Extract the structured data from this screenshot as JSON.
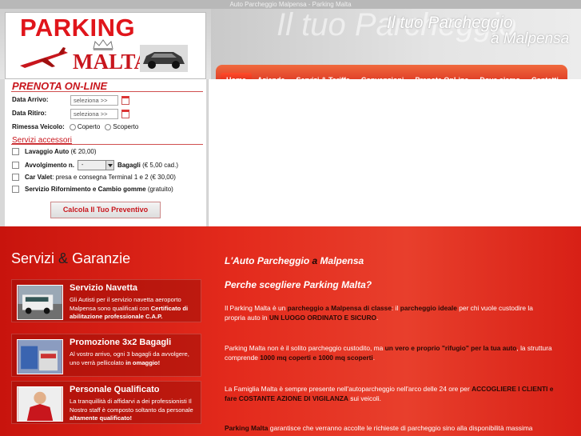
{
  "page_title": "Auto Parcheggio Malpensa - Parking Malta",
  "logo": {
    "line1": "PARKING",
    "line2": "MALTA"
  },
  "header": {
    "ghost_text": "Il tuo Parcheggio",
    "tagline_line1": "Il tuo Parcheggio",
    "tagline_line2": "a Malpensa"
  },
  "nav": [
    {
      "label": "Home"
    },
    {
      "label": "Azienda"
    },
    {
      "label": "Servizi & Tariffe"
    },
    {
      "label": "Convenzioni"
    },
    {
      "label": "Prenota OnLine"
    },
    {
      "label": "Dove siamo"
    },
    {
      "label": "Contatti"
    }
  ],
  "form": {
    "title": "PRENOTA ON-LINE",
    "arrivo_label": "Data Arrivo:",
    "arrivo_value": "seleziona >>",
    "ritiro_label": "Data Ritiro:",
    "ritiro_value": "seleziona >>",
    "rimessa_label": "Rimessa Veicolo:",
    "rimessa_opt1": "Coperto",
    "rimessa_opt2": "Scoperto",
    "servizi_title": "Servizi accessori",
    "lavaggio_label": "Lavaggio Auto",
    "lavaggio_price": "(€ 20,00)",
    "avvolgimento_label": "Avvolgimento n.",
    "avvolgimento_select": "-",
    "bagagli_label": "Bagagli",
    "bagagli_price": "(€ 5,00 cad.)",
    "valet_label": "Car Valet",
    "valet_text": ": presa e consegna Terminal 1 e 2 (€ 30,00)",
    "rifornimento_label": "Servizio Rifornimento e Cambio gomme",
    "rifornimento_text": "(gratuito)",
    "calc_button": "Calcola Il Tuo Preventivo"
  },
  "servizi": {
    "title_part1": "Servizi",
    "title_amp": "&",
    "title_part2": "Garanzie",
    "cards": [
      {
        "title": "Servizio Navetta",
        "text_plain": "Gli Autisti per il servizio navetta aeroporto Malpensa sono qualificati con ",
        "text_bold": "Certificato di abilitazione professionale C.A.P."
      },
      {
        "title": "Promozione 3x2 Bagagli",
        "text_plain": "Al vostro arrivo, ogni 3 bagagli da avvolgere, uno verrà pellicolato ",
        "text_bold": "in omaggio!"
      },
      {
        "title": "Personale Qualificato",
        "text_plain": "La tranquillità di affidarvi a dei professionisti Il Nostro staff è composto soltanto da personale ",
        "text_bold": "altamente qualificato!"
      }
    ]
  },
  "main": {
    "h1_part1": "L'Auto Parcheggio",
    "h1_part2": " a ",
    "h1_part3": "Malpensa",
    "h2": "Perche scegliere Parking Malta?",
    "p1_a": "Il Parking Malta è un ",
    "p1_b": "parcheggio a Malpensa di classe",
    "p1_c": ": il ",
    "p1_d": "parcheggio ideale",
    "p1_e": " per chi vuole custodire la propria auto in ",
    "p1_f": "UN LUOGO ORDINATO E SICURO",
    "p1_g": ".",
    "p2_a": "Parking Malta non è il solito parcheggio custodito, ma ",
    "p2_b": "un vero e proprio \"rifugio\" per la tua auto",
    "p2_c": ", la struttura comprende ",
    "p2_d": "1000 mq coperti e 1000 mq scoperti",
    "p2_e": ".",
    "p3_a": "La Famiglia Malta è sempre presente nell'autoparcheggio nell'arco delle 24 ore per ",
    "p3_b": "ACCOGLIERE I CLIENTI e fare COSTANTE AZIONE DI VIGILANZA",
    "p3_c": " sui veicoli.",
    "p4_a": "Parking Malta",
    "p4_b": " garantisce che verranno accolte le richieste di parcheggio sino alla disponibilità massima"
  },
  "colors": {
    "accent": "#c8161d",
    "nav": "#e0401f",
    "red_bg": "#e32a1c"
  }
}
